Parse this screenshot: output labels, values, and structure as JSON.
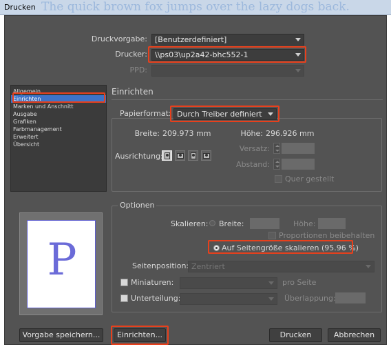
{
  "window": {
    "title": "Drucken",
    "background_text": "The quick brown fox jumps over the lazy dogs back."
  },
  "header": {
    "preset_label": "Druckvorgabe:",
    "preset_value": "[Benutzerdefiniert]",
    "printer_label": "Drucker:",
    "printer_value": "\\\\ps03\\up2a42-bhc552-1",
    "ppd_label": "PPD:",
    "ppd_value": ""
  },
  "sidebar": {
    "items": [
      {
        "label": "Allgemein",
        "active": false
      },
      {
        "label": "Einrichten",
        "active": true
      },
      {
        "label": "Marken und Anschnitt",
        "active": false
      },
      {
        "label": "Ausgabe",
        "active": false
      },
      {
        "label": "Grafiken",
        "active": false
      },
      {
        "label": "Farbmanagement",
        "active": false
      },
      {
        "label": "Erweitert",
        "active": false
      },
      {
        "label": "Übersicht",
        "active": false
      }
    ]
  },
  "preview": {
    "letter": "P"
  },
  "main": {
    "section_title": "Einrichten",
    "paper_label": "Papierformat:",
    "paper_value": "Durch Treiber definiert",
    "width_label": "Breite:",
    "width_value": "209.973 mm",
    "height_label": "Höhe:",
    "height_value": "296.926 mm",
    "orientation_label": "Ausrichtung:",
    "offset_label": "Versatz:",
    "gap_label": "Abstand:",
    "transverse_label": "Quer gestellt"
  },
  "options": {
    "title": "Optionen",
    "scale_label": "Skalieren:",
    "scale_width_label": "Breite:",
    "scale_height_label": "Höhe:",
    "keep_proportions_label": "Proportionen beibehalten",
    "fit_page_label": "Auf Seitengröße skalieren  (95.96 %)",
    "position_label": "Seitenposition:",
    "position_value": "Zentriert",
    "thumbnails_label": "Miniaturen:",
    "per_page_label": "pro Seite",
    "tile_label": "Unterteilung:",
    "overlap_label": "Überlappung:"
  },
  "buttons": {
    "save_preset": "Vorgabe speichern...",
    "setup": "Einrichten...",
    "print": "Drucken",
    "cancel": "Abbrechen"
  },
  "colors": {
    "highlight": "#e8401c",
    "dialog_bg": "#535353",
    "selection": "#3d73c7"
  }
}
